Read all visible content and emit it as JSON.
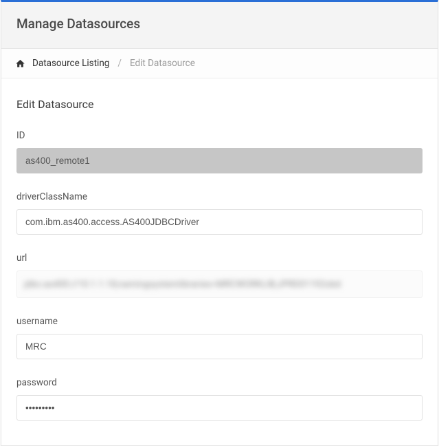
{
  "header": {
    "title": "Manage Datasources"
  },
  "breadcrumb": {
    "home_aria": "Home",
    "link_label": "Datasource Listing",
    "separator": "/",
    "current": "Edit Datasource"
  },
  "form": {
    "title": "Edit Datasource",
    "fields": {
      "id": {
        "label": "ID",
        "value": "as400_remote1"
      },
      "driverClassName": {
        "label": "driverClassName",
        "value": "com.ibm.as400.access.AS400JDBCDriver"
      },
      "url": {
        "label": "url",
        "value_obscured": "jdbc:as400://10.1.1.18;namingsystemlibraries=MRCWORKLIB;JPRD01192obd"
      },
      "username": {
        "label": "username",
        "value": "MRC"
      },
      "password": {
        "label": "password",
        "value": "•••••••••"
      }
    }
  }
}
